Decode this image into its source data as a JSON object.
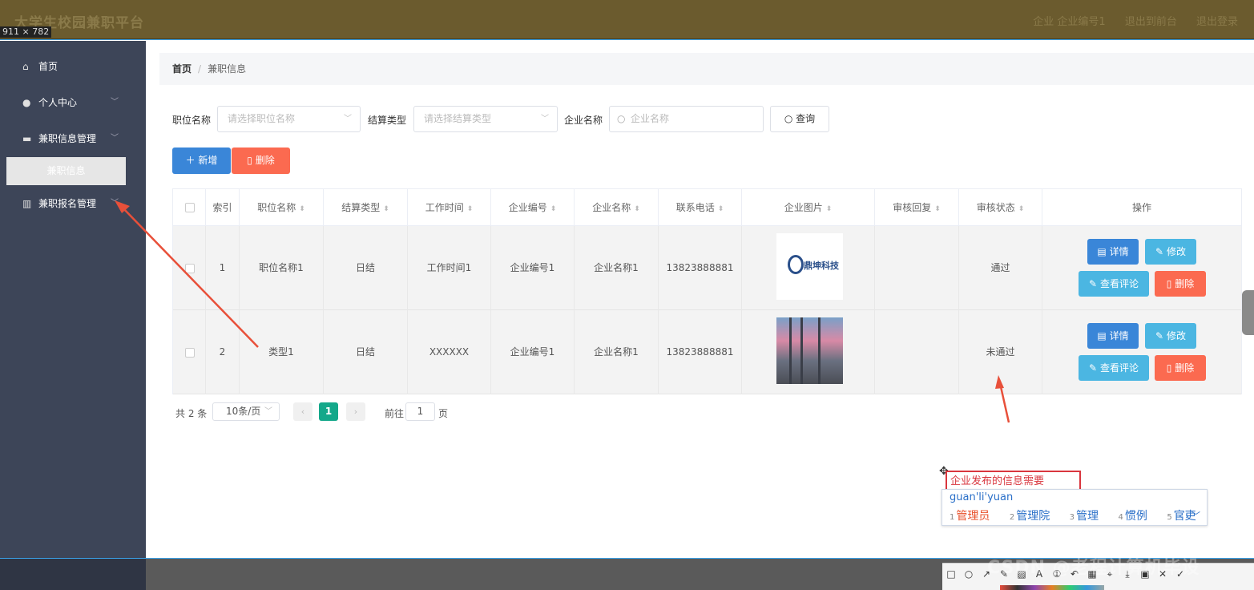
{
  "header": {
    "app_title": "大学生校园兼职平台",
    "dim_badge": "911 × 782",
    "links": [
      "企业 企业编号1",
      "退出到前台",
      "退出登录"
    ]
  },
  "sidebar": {
    "items": [
      {
        "label": "首页",
        "icon": "home-icon"
      },
      {
        "label": "个人中心",
        "icon": "user-icon"
      },
      {
        "label": "兼职信息管理",
        "icon": "chat-icon"
      },
      {
        "label": "兼职报名管理",
        "icon": "chart-icon"
      }
    ],
    "active_submenu": "兼职信息"
  },
  "breadcrumb": {
    "home": "首页",
    "current": "兼职信息"
  },
  "search": {
    "job_label": "职位名称",
    "job_placeholder": "请选择职位名称",
    "settle_label": "结算类型",
    "settle_placeholder": "请选择结算类型",
    "company_label": "企业名称",
    "company_placeholder": "企业名称",
    "query_button": "查询"
  },
  "toolbar": {
    "add": "新增",
    "delete": "删除"
  },
  "table": {
    "headers": [
      "索引",
      "职位名称",
      "结算类型",
      "工作时间",
      "企业编号",
      "企业名称",
      "联系电话",
      "企业图片",
      "审核回复",
      "审核状态",
      "操作"
    ],
    "rows": [
      {
        "index": "1",
        "job": "职位名称1",
        "settle": "日结",
        "time": "工作时间1",
        "company_no": "企业编号1",
        "company": "企业名称1",
        "phone": "13823888881",
        "image_text": "鼎坤科技",
        "reply": "",
        "status": "通过"
      },
      {
        "index": "2",
        "job": "类型1",
        "settle": "日结",
        "time": "XXXXXX",
        "company_no": "企业编号1",
        "company": "企业名称1",
        "phone": "13823888881",
        "image_text": "",
        "reply": "",
        "status": "未通过"
      }
    ],
    "actions": {
      "detail": "详情",
      "edit": "修改",
      "review": "查看评论",
      "delete": "删除"
    }
  },
  "pagination": {
    "total": "共 2 条",
    "page_size": "10条/页",
    "current": "1",
    "goto_prefix": "前往",
    "goto_value": "1",
    "goto_suffix": "页"
  },
  "ime": {
    "typed_text": "企业发布的信息需要",
    "pinyin": "guan'li'yuan",
    "candidates": [
      {
        "n": "1",
        "w": "管理员"
      },
      {
        "n": "2",
        "w": "管理院"
      },
      {
        "n": "3",
        "w": "管理"
      },
      {
        "n": "4",
        "w": "惯例"
      },
      {
        "n": "5",
        "w": "官吏"
      }
    ]
  },
  "watermark": "CSDN @老程计算机毕设",
  "colors": {
    "header": "#6b5b2e",
    "sidebar": "#3d4558",
    "primary": "#3a86d8",
    "danger": "#fb6a50",
    "info": "#4bb6e2",
    "page_active": "#14a88a",
    "annotation": "#e8503a"
  }
}
